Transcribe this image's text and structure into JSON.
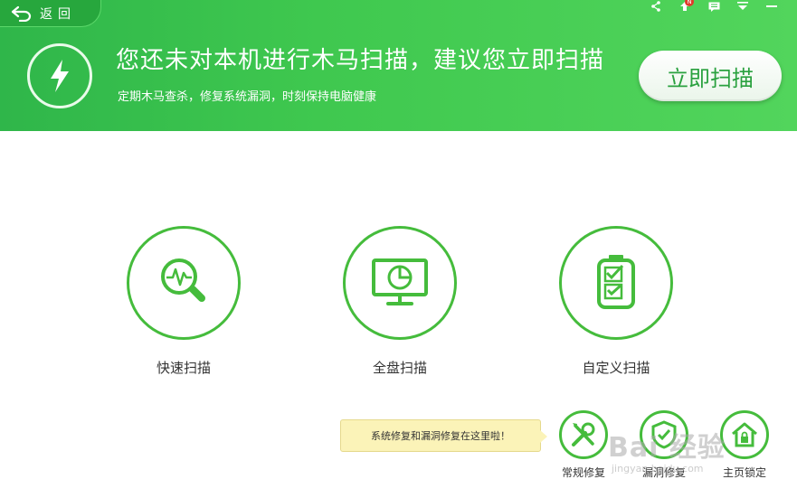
{
  "header": {
    "back_label": "返回",
    "title": "您还未对本机进行木马扫描，建议您立即扫描",
    "subtitle": "定期木马查杀，修复系统漏洞，时刻保持电脑健康",
    "scan_now_label": "立即扫描",
    "notification_count": "N"
  },
  "scan_options": [
    {
      "label": "快速扫描",
      "icon": "magnifier-pulse-icon"
    },
    {
      "label": "全盘扫描",
      "icon": "monitor-icon"
    },
    {
      "label": "自定义扫描",
      "icon": "checklist-icon"
    }
  ],
  "tooltip": "系统修复和漏洞修复在这里啦！",
  "tools": [
    {
      "label": "常规修复",
      "icon": "wrench-screwdriver-icon"
    },
    {
      "label": "漏洞修复",
      "icon": "shield-repair-icon"
    },
    {
      "label": "主页锁定",
      "icon": "home-lock-icon"
    }
  ],
  "watermark": {
    "main": "Bai 经验",
    "sub": "jingyan.baidu.com"
  },
  "colors": {
    "brand_green": "#3fc84f",
    "accent_green": "#45bc3c",
    "tip_bg": "#fbf3b8"
  }
}
